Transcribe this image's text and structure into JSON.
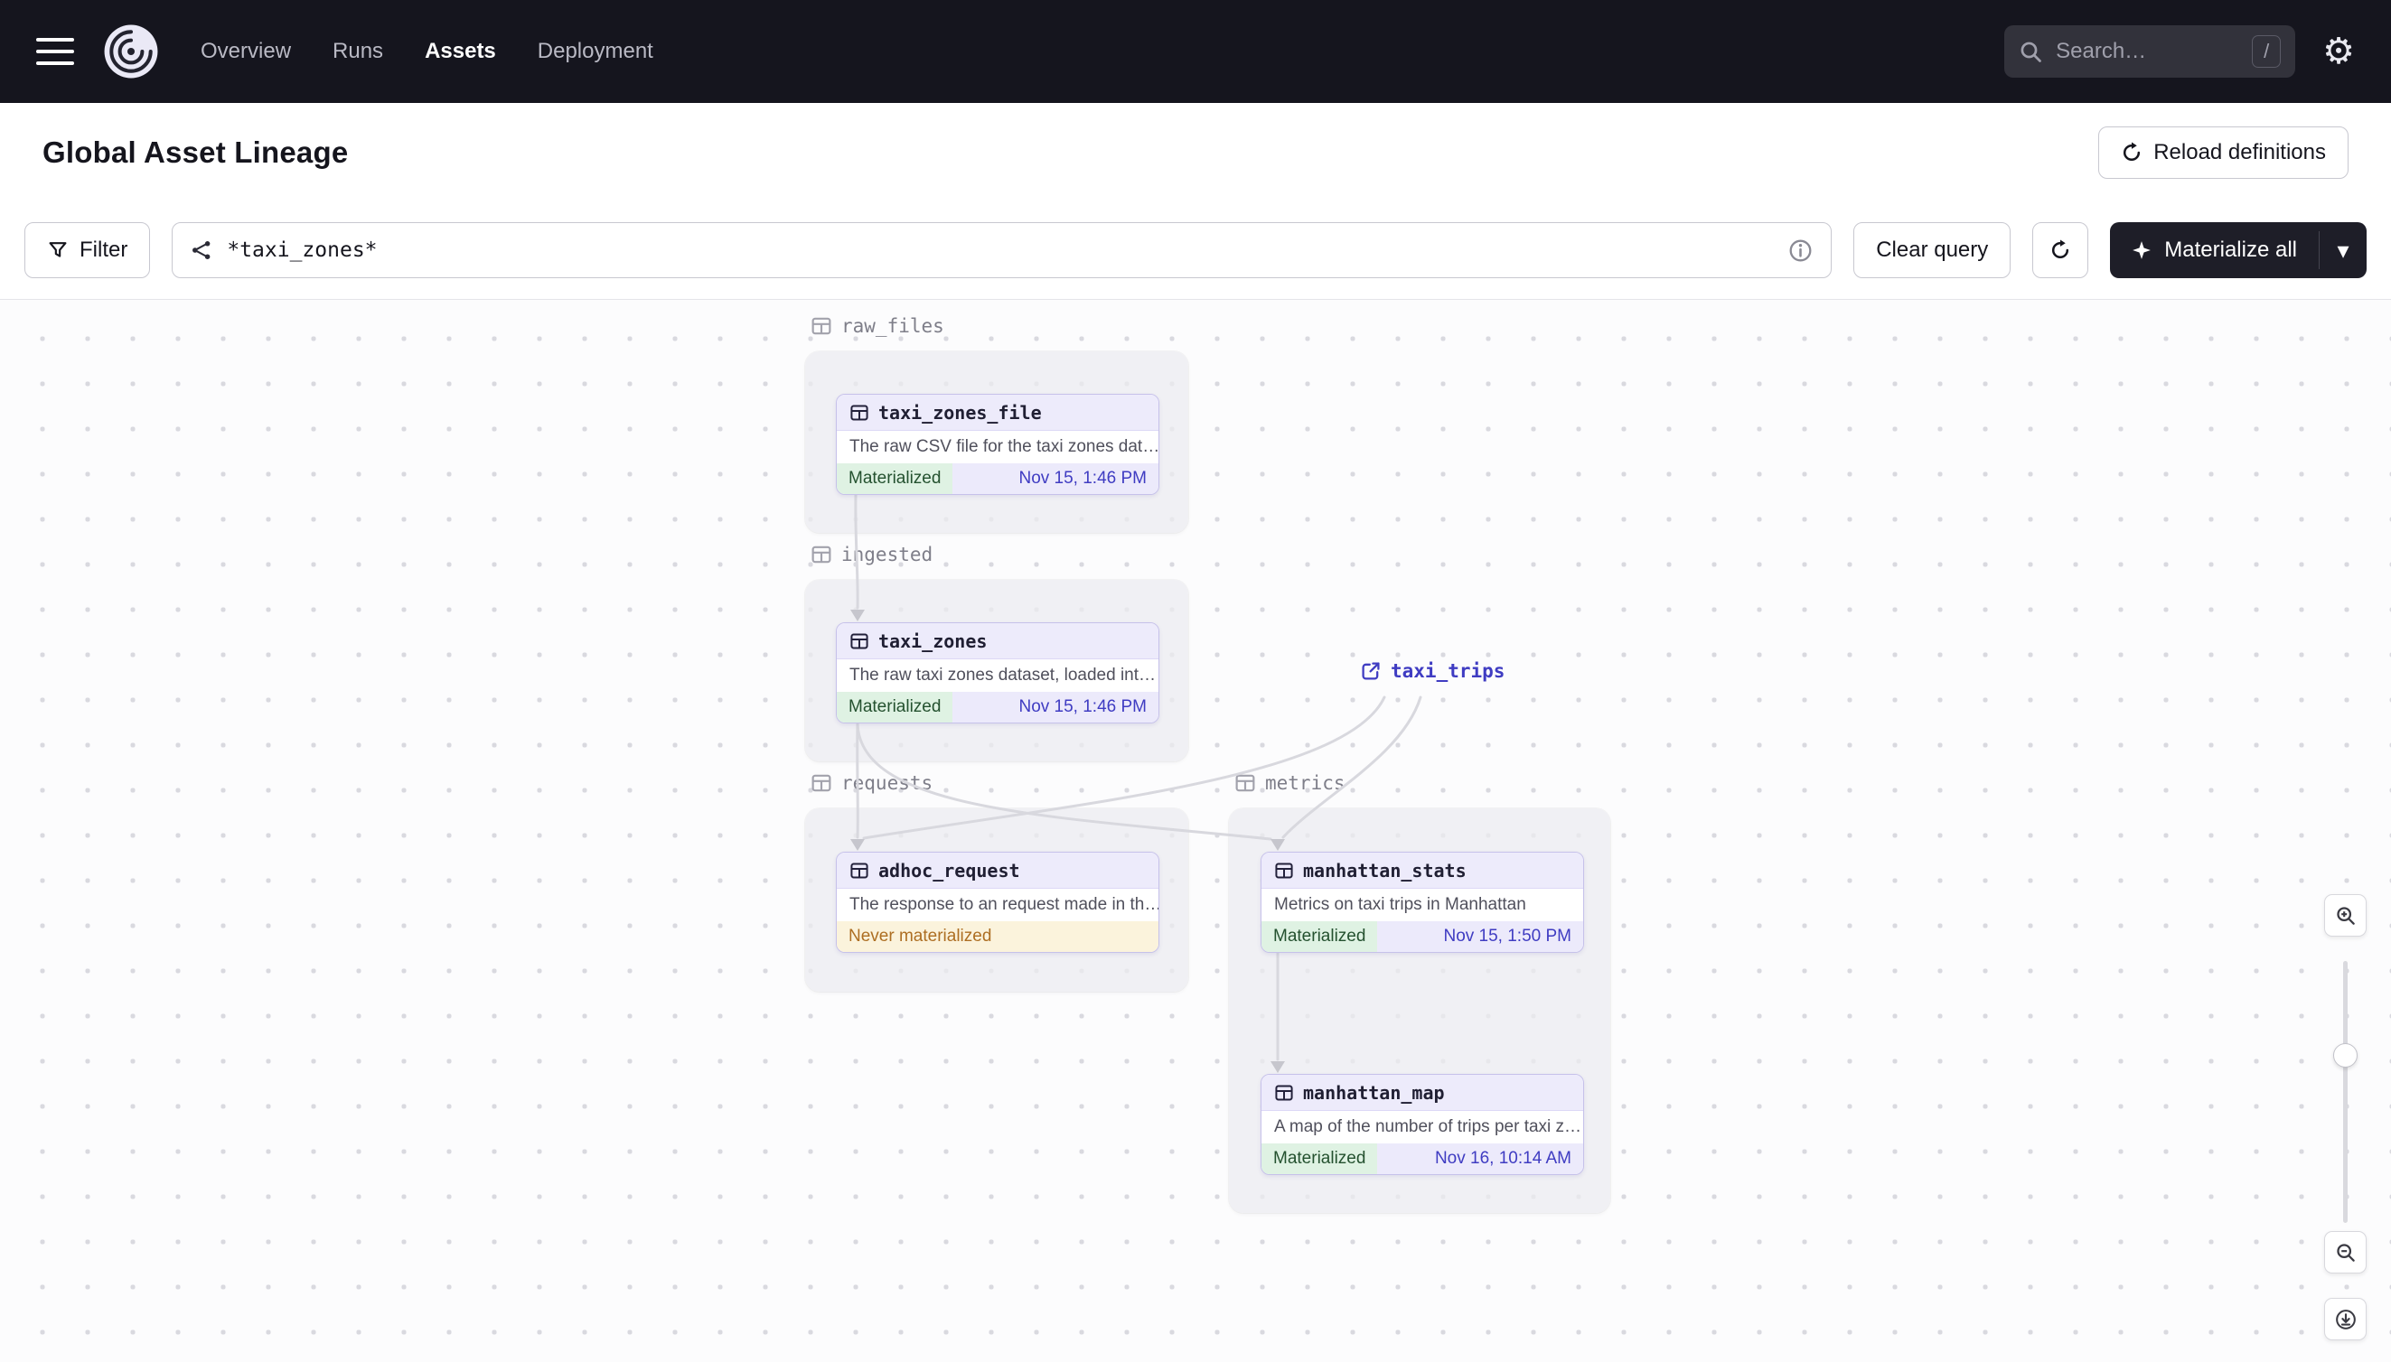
{
  "navbar": {
    "items": [
      {
        "label": "Overview"
      },
      {
        "label": "Runs"
      },
      {
        "label": "Assets"
      },
      {
        "label": "Deployment"
      }
    ],
    "active_item": "Assets",
    "search": {
      "placeholder": "Search…",
      "shortcut": "/"
    }
  },
  "header": {
    "title": "Global Asset Lineage",
    "reload_button": "Reload definitions"
  },
  "toolbar": {
    "filter_button": "Filter",
    "query_value": "*taxi_zones*",
    "clear_button": "Clear query",
    "materialize_button": "Materialize all"
  },
  "graph": {
    "groups": [
      {
        "name": "raw_files"
      },
      {
        "name": "ingested"
      },
      {
        "name": "requests"
      },
      {
        "name": "metrics"
      }
    ],
    "nodes": [
      {
        "id": "taxi_zones_file",
        "group": "raw_files",
        "title": "taxi_zones_file",
        "description": "The raw CSV file for the taxi zones dat…",
        "status": "Materialized",
        "timestamp": "Nov 15, 1:46 PM"
      },
      {
        "id": "taxi_zones",
        "group": "ingested",
        "title": "taxi_zones",
        "description": "The raw taxi zones dataset, loaded int…",
        "status": "Materialized",
        "timestamp": "Nov 15, 1:46 PM"
      },
      {
        "id": "adhoc_request",
        "group": "requests",
        "title": "adhoc_request",
        "description": "The response to an request made in th…",
        "status": "Never materialized",
        "timestamp": ""
      },
      {
        "id": "manhattan_stats",
        "group": "metrics",
        "title": "manhattan_stats",
        "description": "Metrics on taxi trips in Manhattan",
        "status": "Materialized",
        "timestamp": "Nov 15, 1:50 PM"
      },
      {
        "id": "manhattan_map",
        "group": "metrics",
        "title": "manhattan_map",
        "description": "A map of the number of trips per taxi z…",
        "status": "Materialized",
        "timestamp": "Nov 16, 10:14 AM"
      }
    ],
    "external": [
      {
        "name": "taxi_trips"
      }
    ],
    "edges": [
      [
        "taxi_zones_file",
        "taxi_zones"
      ],
      [
        "taxi_zones",
        "adhoc_request"
      ],
      [
        "taxi_zones",
        "manhattan_stats"
      ],
      [
        "taxi_trips",
        "adhoc_request"
      ],
      [
        "taxi_trips",
        "manhattan_stats"
      ],
      [
        "manhattan_stats",
        "manhattan_map"
      ]
    ]
  },
  "icons": {
    "gear": "⚙",
    "caret_down": "▾"
  },
  "colors": {
    "navbar_bg": "#15151E",
    "accent_indigo": "#3F3CC2",
    "materialized_bg": "#DFF2E3",
    "materialized_text": "#24512F",
    "never_materialized_bg": "#FBF3DC",
    "never_materialized_text": "#AD6E22",
    "node_border": "#C6C1EA",
    "node_header_bg": "#EDEBFB",
    "materialize_button_bg": "#1E1E28"
  }
}
